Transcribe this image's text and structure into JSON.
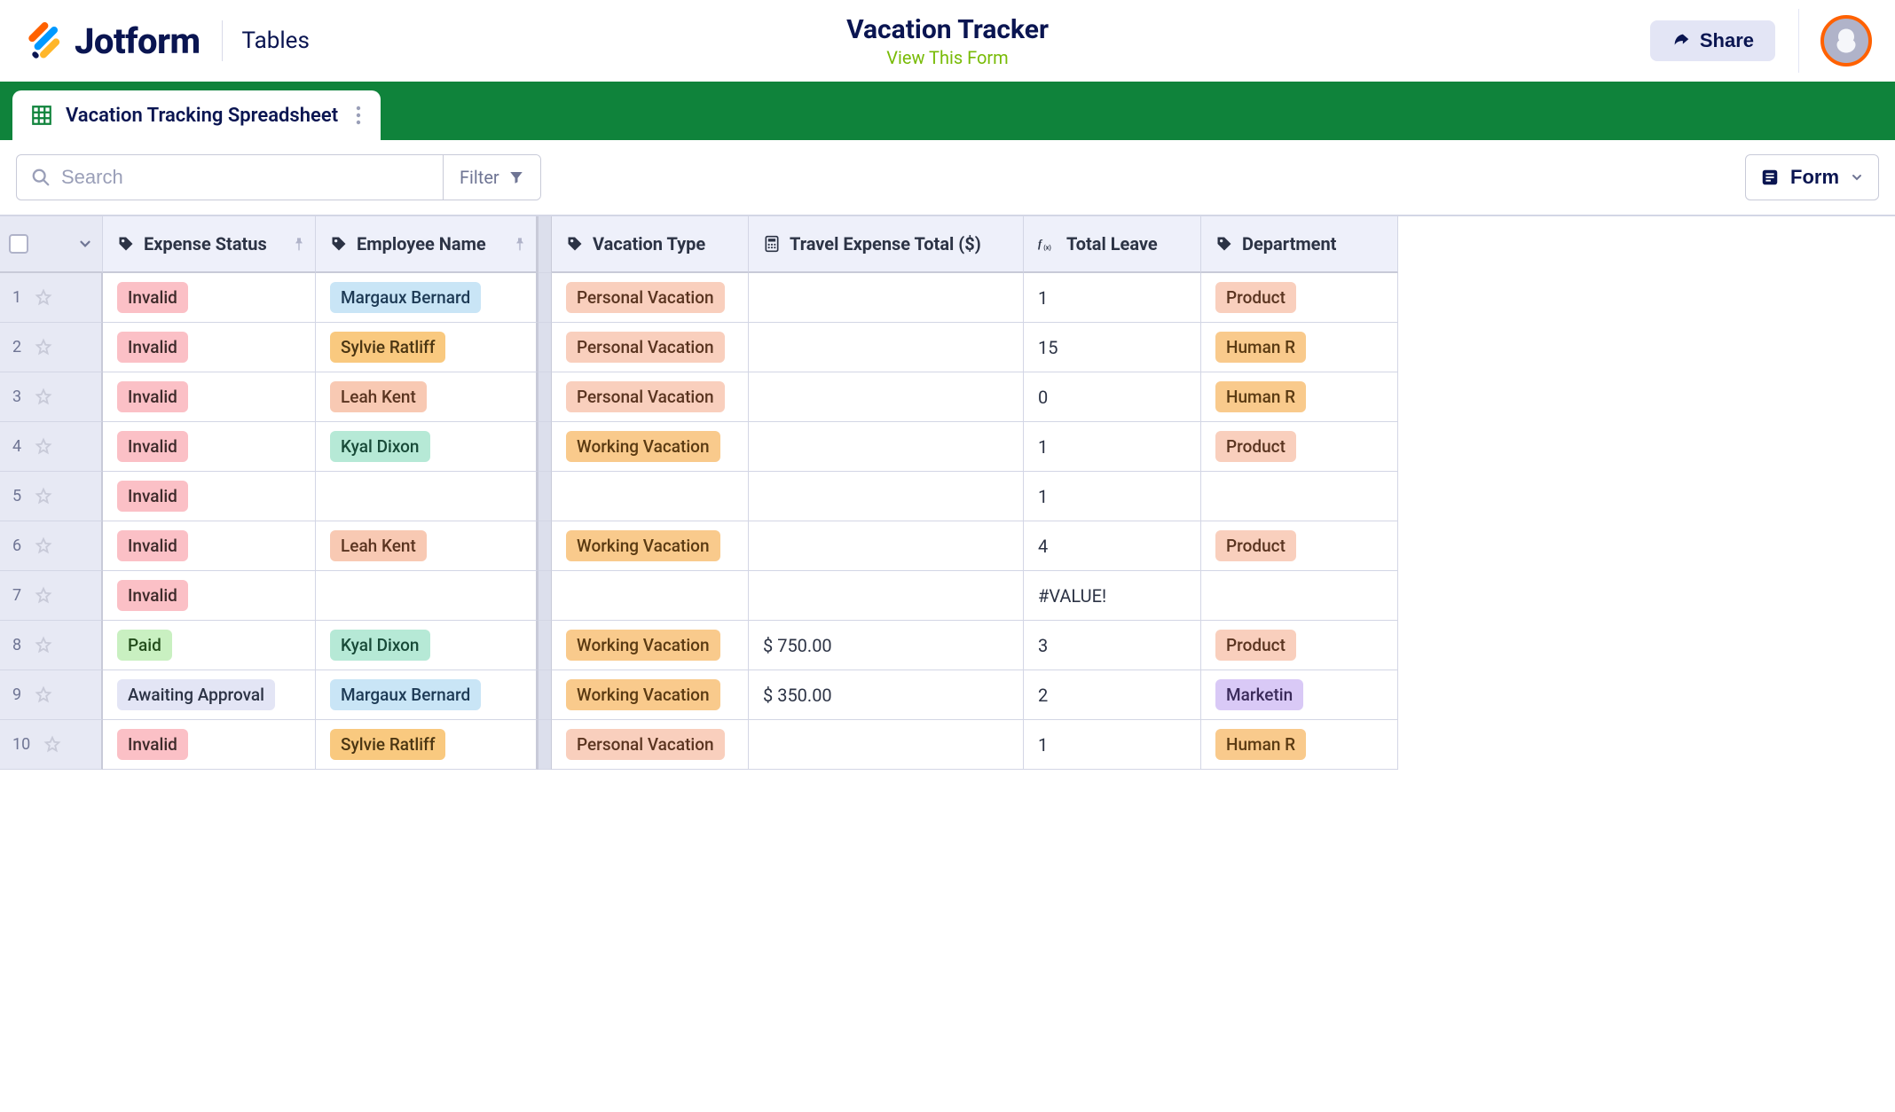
{
  "brand": {
    "name": "Jotform",
    "product": "Tables"
  },
  "page": {
    "title": "Vacation Tracker",
    "subtitle": "View This Form"
  },
  "share": {
    "label": "Share"
  },
  "tab": {
    "label": "Vacation Tracking Spreadsheet"
  },
  "toolbar": {
    "search_placeholder": "Search",
    "filter_label": "Filter",
    "form_label": "Form"
  },
  "columns": {
    "expense_status": "Expense Status",
    "employee_name": "Employee Name",
    "vacation_type": "Vacation Type",
    "travel_expense_total": "Travel Expense Total ($)",
    "total_leave": "Total Leave",
    "department": "Department"
  },
  "rows": [
    {
      "n": "1",
      "status": {
        "text": "Invalid",
        "cls": "c-pink"
      },
      "employee": {
        "text": "Margaux Bernard",
        "cls": "c-blue"
      },
      "vacation": {
        "text": "Personal Vacation",
        "cls": "c-lpeach"
      },
      "expense": "",
      "leave": "1",
      "dept": {
        "text": "Product",
        "cls": "c-lpeach"
      }
    },
    {
      "n": "2",
      "status": {
        "text": "Invalid",
        "cls": "c-pink"
      },
      "employee": {
        "text": "Sylvie Ratliff",
        "cls": "c-orange"
      },
      "vacation": {
        "text": "Personal Vacation",
        "cls": "c-lpeach"
      },
      "expense": "",
      "leave": "15",
      "dept": {
        "text": "Human R",
        "cls": "c-lorange"
      }
    },
    {
      "n": "3",
      "status": {
        "text": "Invalid",
        "cls": "c-pink"
      },
      "employee": {
        "text": "Leah Kent",
        "cls": "c-peach"
      },
      "vacation": {
        "text": "Personal Vacation",
        "cls": "c-lpeach"
      },
      "expense": "",
      "leave": "0",
      "dept": {
        "text": "Human R",
        "cls": "c-lorange"
      }
    },
    {
      "n": "4",
      "status": {
        "text": "Invalid",
        "cls": "c-pink"
      },
      "employee": {
        "text": "Kyal Dixon",
        "cls": "c-mint"
      },
      "vacation": {
        "text": "Working Vacation",
        "cls": "c-lorange"
      },
      "expense": "",
      "leave": "1",
      "dept": {
        "text": "Product",
        "cls": "c-lpeach"
      }
    },
    {
      "n": "5",
      "status": {
        "text": "Invalid",
        "cls": "c-pink"
      },
      "employee": null,
      "vacation": null,
      "expense": "",
      "leave": "1",
      "dept": null
    },
    {
      "n": "6",
      "status": {
        "text": "Invalid",
        "cls": "c-pink"
      },
      "employee": {
        "text": "Leah Kent",
        "cls": "c-peach"
      },
      "vacation": {
        "text": "Working Vacation",
        "cls": "c-lorange"
      },
      "expense": "",
      "leave": "4",
      "dept": {
        "text": "Product",
        "cls": "c-lpeach"
      }
    },
    {
      "n": "7",
      "status": {
        "text": "Invalid",
        "cls": "c-pink"
      },
      "employee": null,
      "vacation": null,
      "expense": "",
      "leave": "#VALUE!",
      "dept": null
    },
    {
      "n": "8",
      "status": {
        "text": "Paid",
        "cls": "c-lgreen"
      },
      "employee": {
        "text": "Kyal Dixon",
        "cls": "c-mint"
      },
      "vacation": {
        "text": "Working Vacation",
        "cls": "c-lorange"
      },
      "expense": "$ 750.00",
      "leave": "3",
      "dept": {
        "text": "Product",
        "cls": "c-lpeach"
      }
    },
    {
      "n": "9",
      "status": {
        "text": "Awaiting Approval",
        "cls": "c-lgrey"
      },
      "employee": {
        "text": "Margaux Bernard",
        "cls": "c-blue"
      },
      "vacation": {
        "text": "Working Vacation",
        "cls": "c-lorange"
      },
      "expense": "$ 350.00",
      "leave": "2",
      "dept": {
        "text": "Marketin",
        "cls": "c-purple"
      }
    },
    {
      "n": "10",
      "status": {
        "text": "Invalid",
        "cls": "c-pink"
      },
      "employee": {
        "text": "Sylvie Ratliff",
        "cls": "c-orange"
      },
      "vacation": {
        "text": "Personal Vacation",
        "cls": "c-lpeach"
      },
      "expense": "",
      "leave": "1",
      "dept": {
        "text": "Human R",
        "cls": "c-lorange"
      }
    }
  ]
}
